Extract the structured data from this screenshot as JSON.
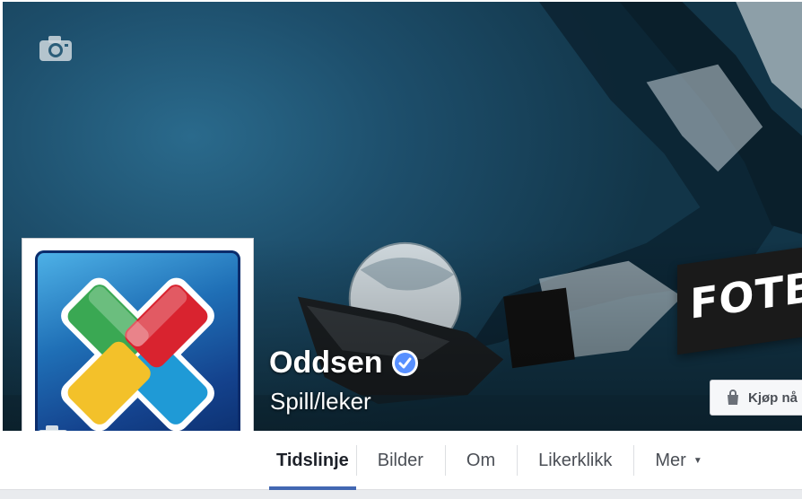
{
  "cover": {
    "banner_text": "FOTB",
    "camera_icon": "camera-icon",
    "buy_button_label": "Kjøp nå",
    "buy_icon": "shopping-bag-icon"
  },
  "profile": {
    "name": "Oddsen",
    "category": "Spill/leker",
    "verified_icon": "verified-badge-icon",
    "logo_colors": [
      "#3aa853",
      "#d9232f",
      "#f3c12a",
      "#1f9ad6"
    ],
    "camera_icon": "camera-icon"
  },
  "nav": {
    "tabs": [
      {
        "label": "Tidslinje",
        "active": true
      },
      {
        "label": "Bilder",
        "active": false
      },
      {
        "label": "Om",
        "active": false
      },
      {
        "label": "Likerklikk",
        "active": false
      },
      {
        "label": "Mer",
        "active": false,
        "dropdown": true
      }
    ],
    "accent": "#4267b2"
  }
}
